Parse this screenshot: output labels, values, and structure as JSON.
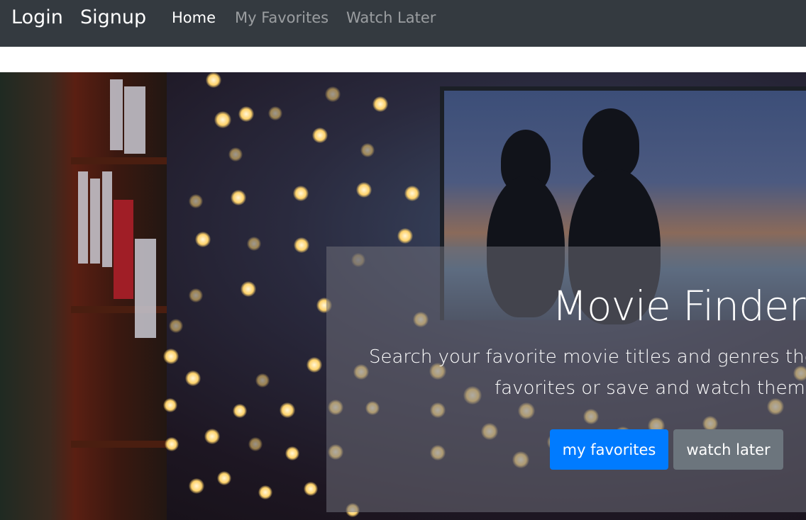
{
  "navbar": {
    "login_label": "Login",
    "signup_label": "Signup",
    "links": [
      {
        "label": "Home",
        "active": true
      },
      {
        "label": "My Favorites",
        "active": false
      },
      {
        "label": "Watch Later",
        "active": false
      }
    ]
  },
  "hero": {
    "title": "Movie Finder",
    "description_line1": "Search your favorite movie titles and genres then",
    "description_line2": "favorites or save and watch them la",
    "favorites_button": "my favorites",
    "watch_later_button": "watch later"
  },
  "colors": {
    "navbar_bg": "#343a40",
    "primary": "#007bff",
    "secondary": "#6c757d"
  }
}
